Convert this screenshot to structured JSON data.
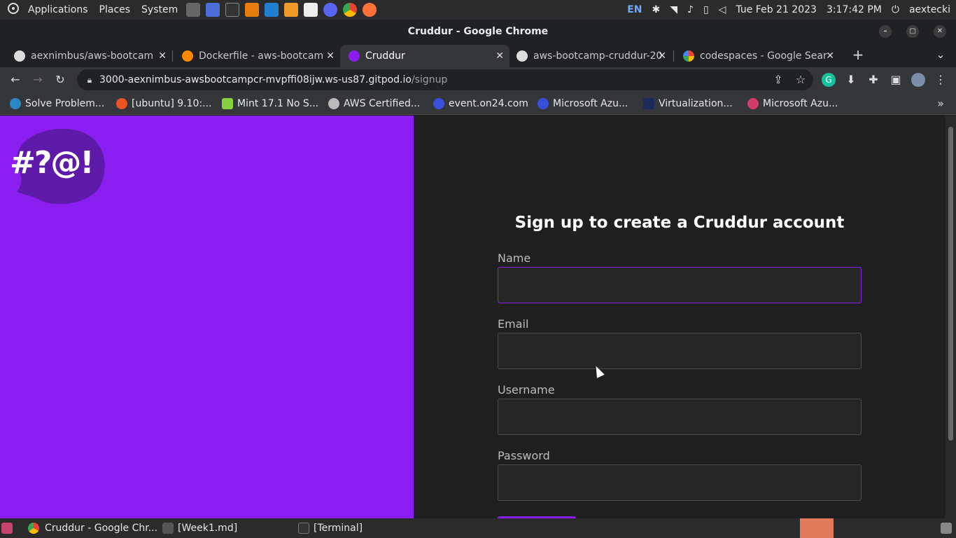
{
  "os_panel": {
    "menus": [
      "Applications",
      "Places",
      "System"
    ],
    "language": "EN",
    "datetime": "Tue Feb 21 2023",
    "time": "3:17:42 PM",
    "user": "aextecki"
  },
  "window": {
    "title": "Cruddur - Google Chrome"
  },
  "tabs": [
    {
      "label": "aexnimbus/aws-bootcam",
      "active": false
    },
    {
      "label": "Dockerfile - aws-bootcam",
      "active": false
    },
    {
      "label": "Cruddur",
      "active": true
    },
    {
      "label": "aws-bootcamp-cruddur-20",
      "active": false
    },
    {
      "label": "codespaces - Google Sear",
      "active": false
    }
  ],
  "address_bar": {
    "host": "3000-aexnimbus-awsbootcampcr-mvpffi08ijw.ws-us87.gitpod.io",
    "path": "/signup"
  },
  "bookmarks": [
    "Solve Problem...",
    "[ubuntu] 9.10:...",
    "Mint 17.1 No S...",
    "AWS Certified...",
    "event.on24.com",
    "Microsoft Azu...",
    "Virtualization...",
    "Microsoft Azu..."
  ],
  "logo": {
    "text": "#?@!"
  },
  "signup_form": {
    "title": "Sign up to create a Cruddur account",
    "fields": [
      {
        "label": "Name",
        "value": "",
        "focused": true
      },
      {
        "label": "Email",
        "value": "",
        "focused": false
      },
      {
        "label": "Username",
        "value": "",
        "focused": false
      },
      {
        "label": "Password",
        "value": "",
        "focused": false
      }
    ]
  },
  "taskbar": {
    "items": [
      "Cruddur - Google Chr...",
      "[Week1.md]",
      "[Terminal]"
    ]
  },
  "colors": {
    "brand_purple": "#8a1ef0",
    "page_dark": "#1f1f1f",
    "logo_bubble": "#5e1aa8"
  }
}
